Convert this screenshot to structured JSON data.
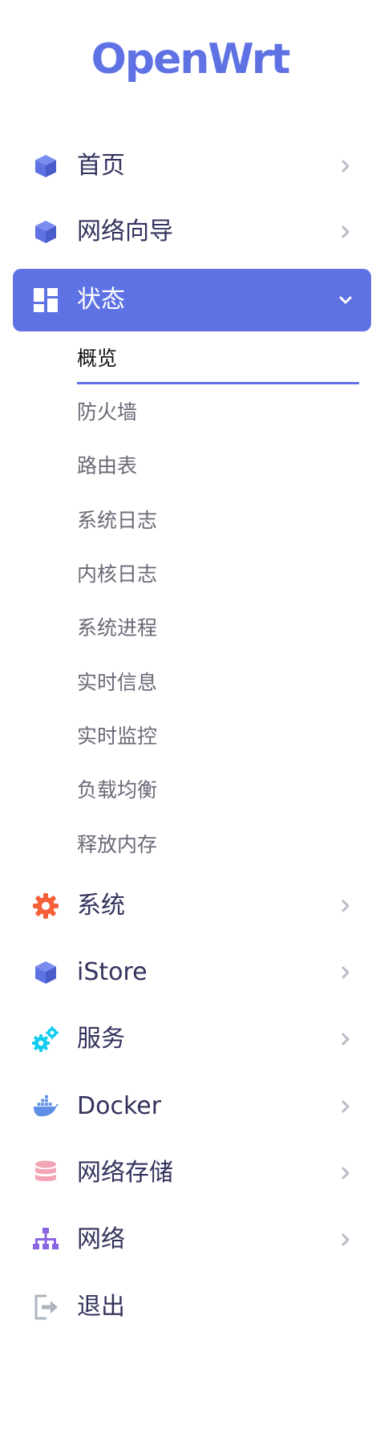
{
  "brand": {
    "logo_text": "OpenWrt",
    "accent": "#5e72e4"
  },
  "nav": {
    "home": "首页",
    "wizard": "网络向导",
    "status": "状态",
    "status_sub": [
      "概览",
      "防火墙",
      "路由表",
      "系统日志",
      "内核日志",
      "系统进程",
      "实时信息",
      "实时监控",
      "负载均衡",
      "释放内存"
    ],
    "system": "系统",
    "istore": "iStore",
    "services": "服务",
    "docker": "Docker",
    "nas": "网络存储",
    "network": "网络",
    "logout": "退出"
  },
  "icons": {
    "home": "cube-icon",
    "wizard": "cube-icon",
    "status": "dashboard-icon",
    "system": "gear-icon",
    "istore": "cube-icon",
    "services": "gears-icon",
    "docker": "docker-icon",
    "nas": "database-icon",
    "network": "sitemap-icon",
    "logout": "sign-out-icon"
  },
  "colors": {
    "gear": "#f5603a",
    "services": "#11cdef",
    "docker": "#5e8fe4",
    "database": "#f3a4b5",
    "sitemap": "#8965e0",
    "logout": "#adb5bd"
  }
}
